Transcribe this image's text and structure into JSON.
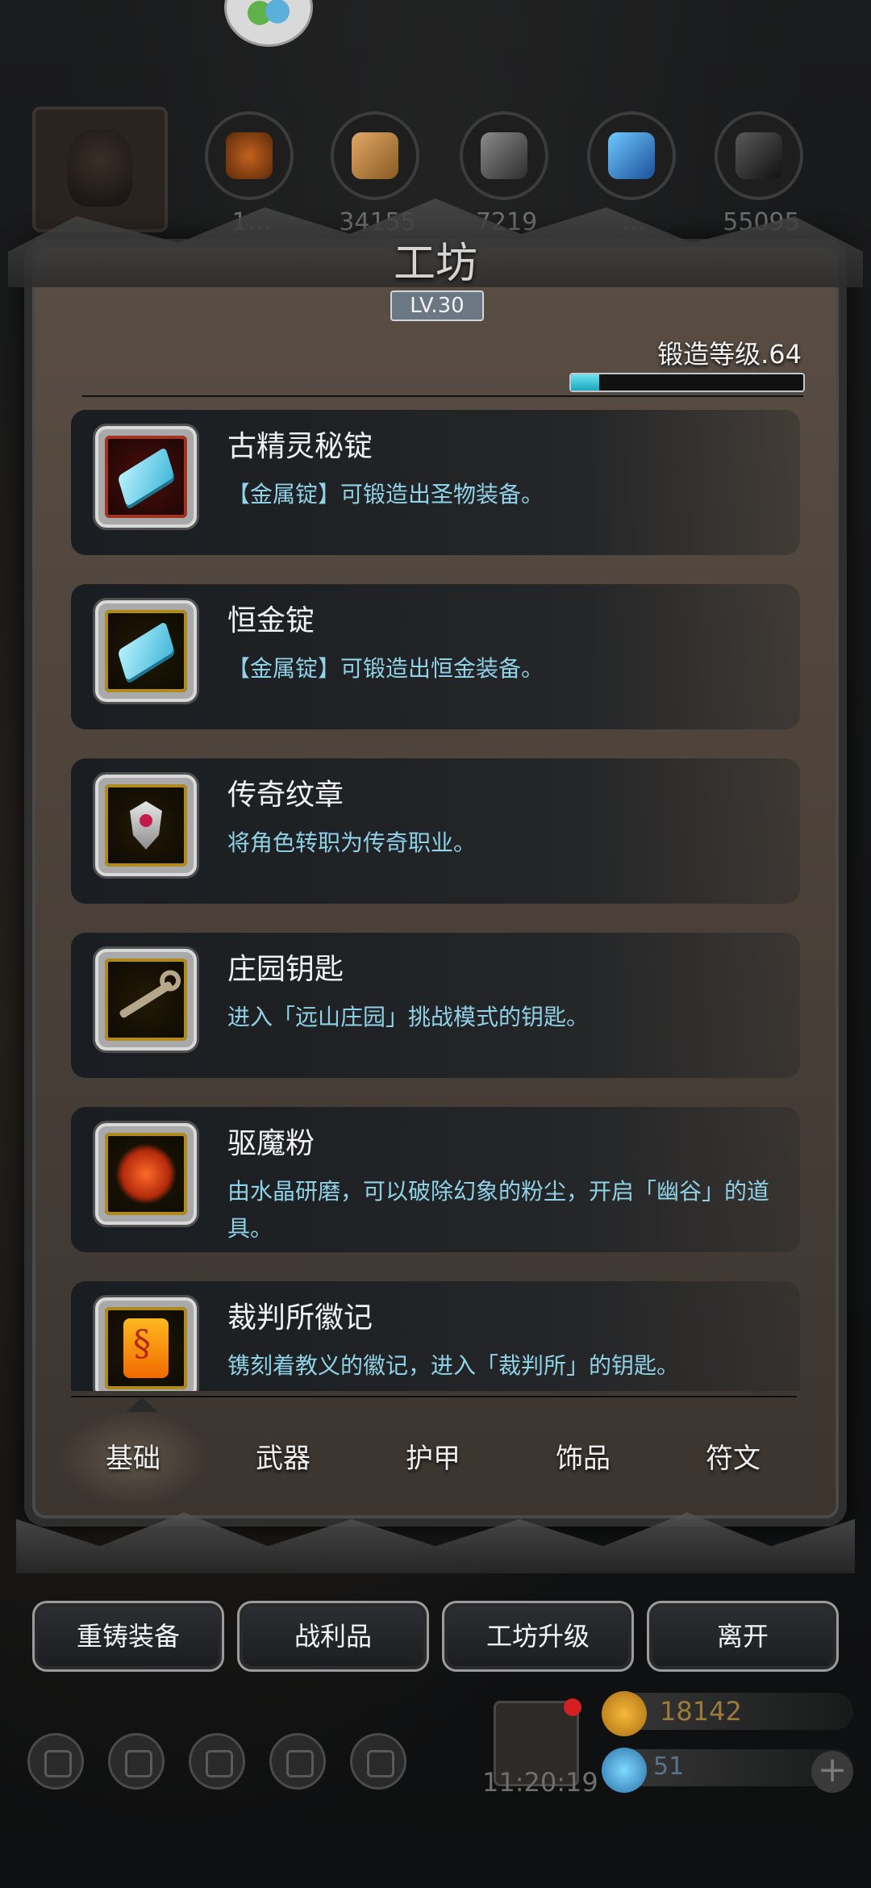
{
  "header": {
    "title": "工坊",
    "level": "LV.30",
    "forge_level": "锻造等级.64",
    "forge_progress": 0.12
  },
  "resources": [
    {
      "icon": "leather-icon",
      "count": "1…"
    },
    {
      "icon": "wood-plank-icon",
      "count": "34155"
    },
    {
      "icon": "iron-ingot-icon",
      "count": "7219"
    },
    {
      "icon": "crystal-shard-icon",
      "count": "…"
    },
    {
      "icon": "dark-iron-icon",
      "count": "55095"
    }
  ],
  "items": [
    {
      "name": "古精灵秘锭",
      "desc": "【金属锭】可锻造出圣物装备。",
      "icon": "blue-ingot-icon"
    },
    {
      "name": "恒金锭",
      "desc": "【金属锭】可锻造出恒金装备。",
      "icon": "blue-ingot-icon"
    },
    {
      "name": "传奇纹章",
      "desc": "将角色转职为传奇职业。",
      "icon": "crest-icon"
    },
    {
      "name": "庄园钥匙",
      "desc": "进入「远山庄园」挑战模式的钥匙。",
      "icon": "key-icon"
    },
    {
      "name": "驱魔粉",
      "desc": "由水晶研磨，可以破除幻象的粉尘，开启「幽谷」的道具。",
      "icon": "powder-icon"
    },
    {
      "name": "裁判所徽记",
      "desc": "镌刻着教义的徽记，进入「裁判所」的钥匙。",
      "icon": "seal-icon"
    }
  ],
  "tabs": [
    "基础",
    "武器",
    "护甲",
    "饰品",
    "符文"
  ],
  "active_tab": "基础",
  "buttons": {
    "reforge": "重铸装备",
    "loot": "战利品",
    "upgrade": "工坊升级",
    "leave": "离开"
  },
  "footer": {
    "time": "11:20:19",
    "gold": "18142",
    "gems": "51",
    "add_symbol": "+"
  },
  "colors": {
    "desc_text": "#8fd1e6",
    "progress_fill": "#1aa6bd"
  }
}
